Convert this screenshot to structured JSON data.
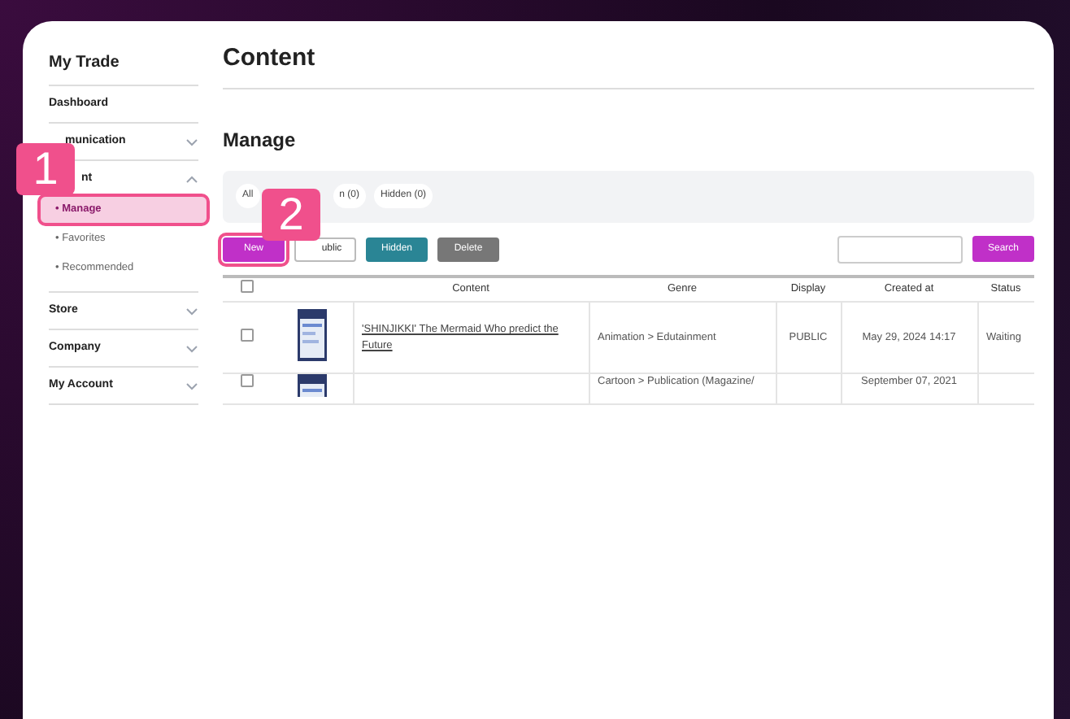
{
  "sidebar": {
    "title": "My Trade",
    "items": [
      {
        "label": "Dashboard",
        "kind": "link"
      },
      {
        "label": "munication",
        "kind": "group",
        "expanded": false
      },
      {
        "label": "nt",
        "kind": "group",
        "expanded": true,
        "callout": "1",
        "children": [
          {
            "label": "• Manage",
            "selected": true
          },
          {
            "label": "• Favorites",
            "selected": false
          },
          {
            "label": "• Recommended",
            "selected": false
          }
        ]
      },
      {
        "label": "Store",
        "kind": "group",
        "expanded": false
      },
      {
        "label": "Company",
        "kind": "group",
        "expanded": false
      },
      {
        "label": "My Account",
        "kind": "group",
        "expanded": false
      }
    ]
  },
  "page_title": "Content",
  "section_title": "Manage",
  "filters": [
    {
      "label": "All"
    },
    {
      "label": "n (0)"
    },
    {
      "label": "Hidden (0)"
    }
  ],
  "callout_2": "2",
  "buttons": [
    {
      "label": "New",
      "kind": "new"
    },
    {
      "label": "ublic",
      "kind": "outline"
    },
    {
      "label": "Hidden",
      "kind": "teal"
    },
    {
      "label": "Delete",
      "kind": "gray"
    }
  ],
  "search": {
    "button": "Search"
  },
  "table": {
    "header_checked": false,
    "columns": [
      "Content",
      "Genre",
      "Display",
      "Created at",
      "Status"
    ],
    "rows": [
      {
        "checked": false,
        "title": "'SHINJIKKI' The Mermaid Who predict the Future",
        "genre": "Animation > Edutainment",
        "display": "PUBLIC",
        "created": "May 29, 2024 14:17",
        "status": "Waiting"
      },
      {
        "checked": false,
        "genre": "Cartoon > Publication (Magazine/",
        "created": "September 07, 2021"
      }
    ]
  }
}
